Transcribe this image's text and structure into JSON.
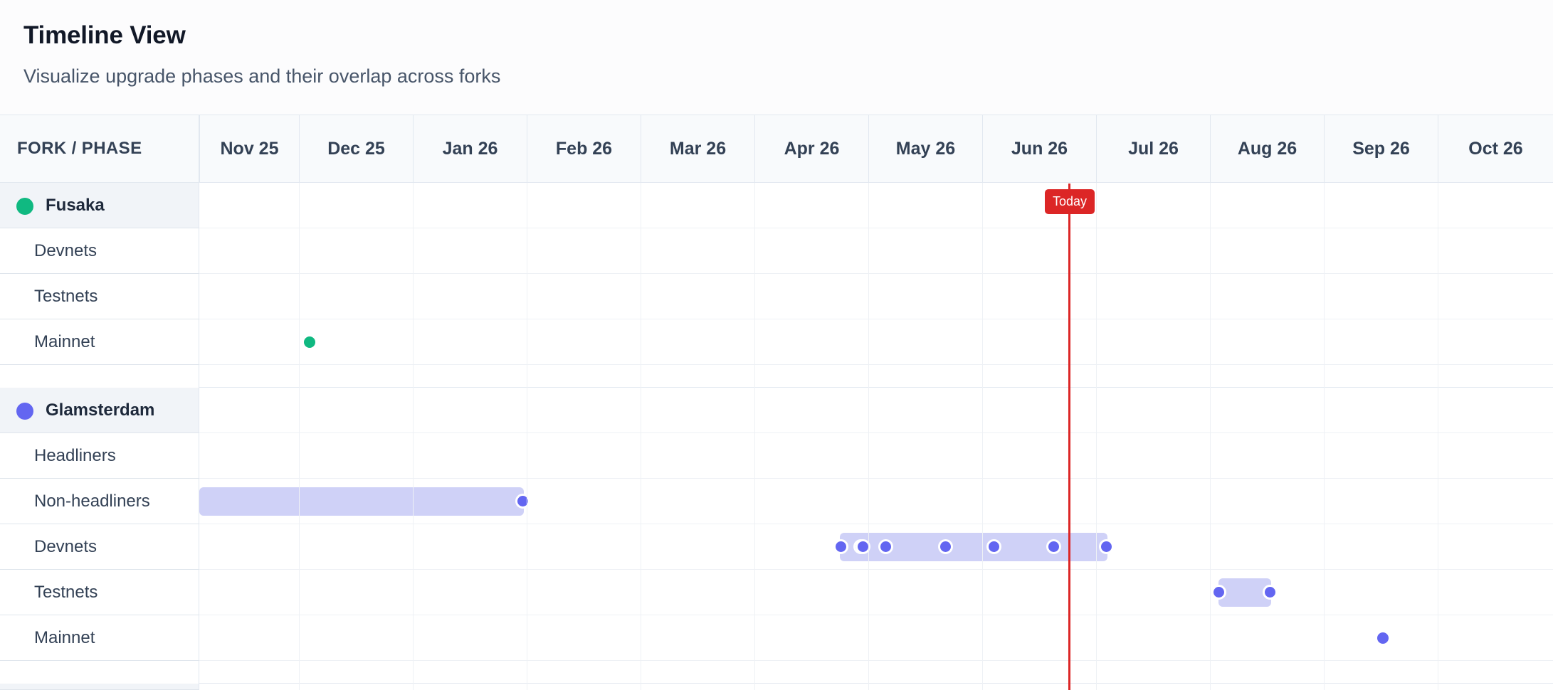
{
  "header": {
    "title": "Timeline View",
    "subtitle": "Visualize upgrade phases and their overlap across forks"
  },
  "grid": {
    "fork_phase_label": "FORK / PHASE",
    "months": [
      "Nov 25",
      "Dec 25",
      "Jan 26",
      "Feb 26",
      "Mar 26",
      "Apr 26",
      "May 26",
      "Jun 26",
      "Jul 26",
      "Aug 26",
      "Sep 26",
      "Oct 26"
    ],
    "today_label": "Today"
  },
  "colors": {
    "fusaka": "#10b981",
    "glamsterdam": "#6366f1",
    "bar_fill": "#cfd1f7",
    "today": "#dc2626"
  },
  "forks": [
    {
      "name": "Fusaka",
      "color": "#10b981",
      "phases": [
        {
          "label": "Devnets"
        },
        {
          "label": "Testnets"
        },
        {
          "label": "Mainnet"
        }
      ]
    },
    {
      "name": "Glamsterdam",
      "color": "#6366f1",
      "phases": [
        {
          "label": "Headliners"
        },
        {
          "label": "Non-headliners"
        },
        {
          "label": "Devnets"
        },
        {
          "label": "Testnets"
        },
        {
          "label": "Mainnet"
        }
      ]
    }
  ]
}
